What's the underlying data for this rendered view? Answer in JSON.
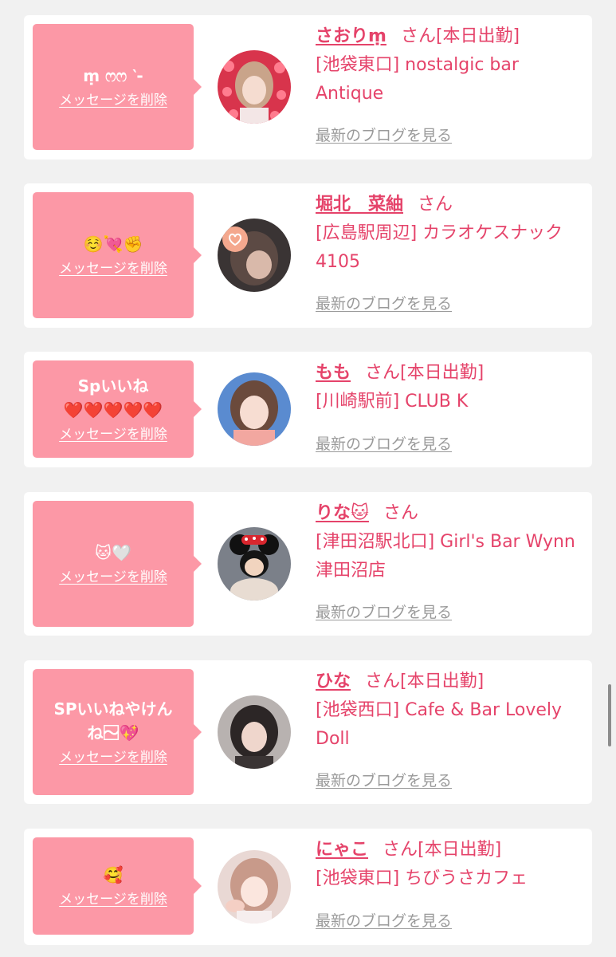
{
  "common": {
    "delete_label": "メッセージを削除",
    "blog_label": "最新のブログを見る"
  },
  "cards": [
    {
      "message": "ṃ ෆෆ ‵-",
      "name": "さおりṃ",
      "suffix": "さん[本日出勤]",
      "shop": "[池袋東口] nostalgic bar Antique",
      "avatar": "avatar-photo-saori"
    },
    {
      "message": "☺️💘✊",
      "name": "堀北　菜紬",
      "suffix": "さん",
      "shop": "[広島駅周辺] カラオケスナック 4105",
      "avatar": "avatar-photo-horikita"
    },
    {
      "message": "Spいいね\n❤️❤️❤️❤️❤️",
      "name": "もも",
      "suffix": "さん[本日出勤]",
      "shop": "[川崎駅前] CLUB K",
      "avatar": "avatar-photo-momo"
    },
    {
      "message": "🐱🤍",
      "name": "りな🐱",
      "suffix": "さん",
      "shop": "[津田沼駅北口] Girl's Bar Wynn 津田沼店",
      "avatar": "avatar-photo-rina"
    },
    {
      "message": "SPいいねやけんね〜⃞⃞💖",
      "name": "ひな",
      "suffix": "さん[本日出勤]",
      "shop": "[池袋西口] Cafe & Bar Lovely Doll",
      "avatar": "avatar-photo-hina"
    },
    {
      "message": "🥰",
      "name": "にゃこ",
      "suffix": "さん[本日出勤]",
      "shop": "[池袋東口] ちびうさカフェ",
      "avatar": "avatar-photo-nyako"
    }
  ],
  "colors": {
    "page_background": "#f1f1f1",
    "card_background": "#ffffff",
    "bubble": "#fc98a6",
    "accent_text": "#e5436a",
    "link_gray": "#9a9a9a"
  }
}
